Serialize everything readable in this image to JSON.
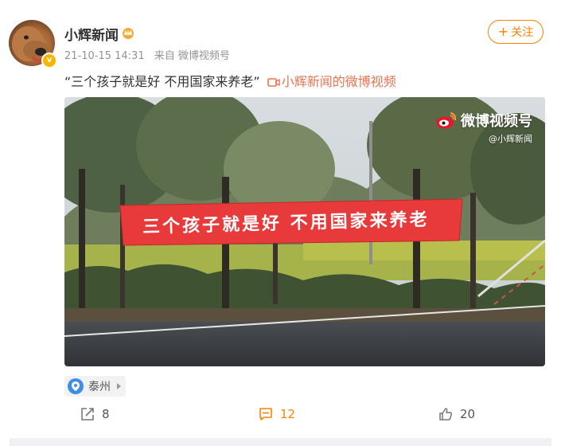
{
  "user": {
    "name": "小辉新闻",
    "verified_mark": "v",
    "badge_icon": "crown-icon"
  },
  "meta": {
    "timestamp": "21-10-15 14:31",
    "source": "来自 微博视频号"
  },
  "follow": {
    "label": "关注",
    "plus": "+"
  },
  "post": {
    "text": "“三个孩子就是好  不用国家来养老”",
    "video_link": "小辉新闻的微博视频"
  },
  "video": {
    "watermark_title": "微博视频号",
    "watermark_sub": "@小辉新闻",
    "banner_text": "三个孩子就是好  不用国家来养老"
  },
  "location": {
    "label": "泰州"
  },
  "actions": {
    "repost_count": "8",
    "comment_count": "12",
    "like_count": "20"
  },
  "colors": {
    "accent": "#ff8200",
    "link": "#eb7350",
    "banner": "#e83a3a",
    "location_pin": "#3e8ee8"
  }
}
